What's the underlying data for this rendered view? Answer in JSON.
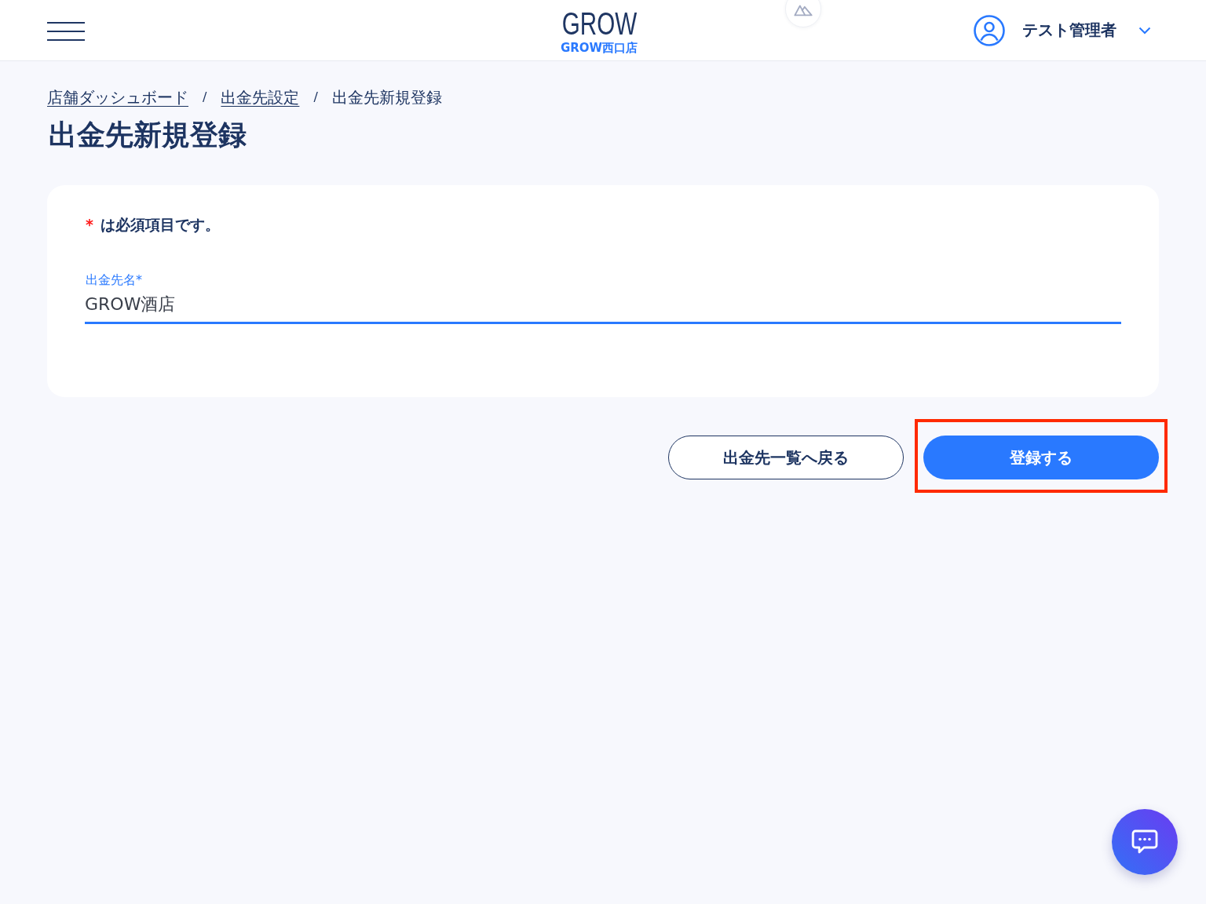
{
  "header": {
    "logo": "GROW",
    "store_name": "GROW西口店",
    "user_name": "テスト管理者"
  },
  "breadcrumb": [
    {
      "kind": "link",
      "label": "店舗ダッシュボード"
    },
    {
      "kind": "separator",
      "label": "/"
    },
    {
      "kind": "link",
      "label": "出金先設定"
    },
    {
      "kind": "separator",
      "label": "/"
    },
    {
      "kind": "current",
      "label": "出金先新規登録"
    }
  ],
  "page_title": "出金先新規登録",
  "form": {
    "required_mark": "*",
    "required_note": "は必須項目です。",
    "fields": [
      {
        "label": "出金先名*",
        "value": "GROW酒店",
        "focused": true
      }
    ]
  },
  "buttons": [
    {
      "kind": "secondary",
      "label": "出金先一覧へ戻る",
      "highlighted": false
    },
    {
      "kind": "primary",
      "label": "登録する",
      "highlighted": true
    }
  ]
}
